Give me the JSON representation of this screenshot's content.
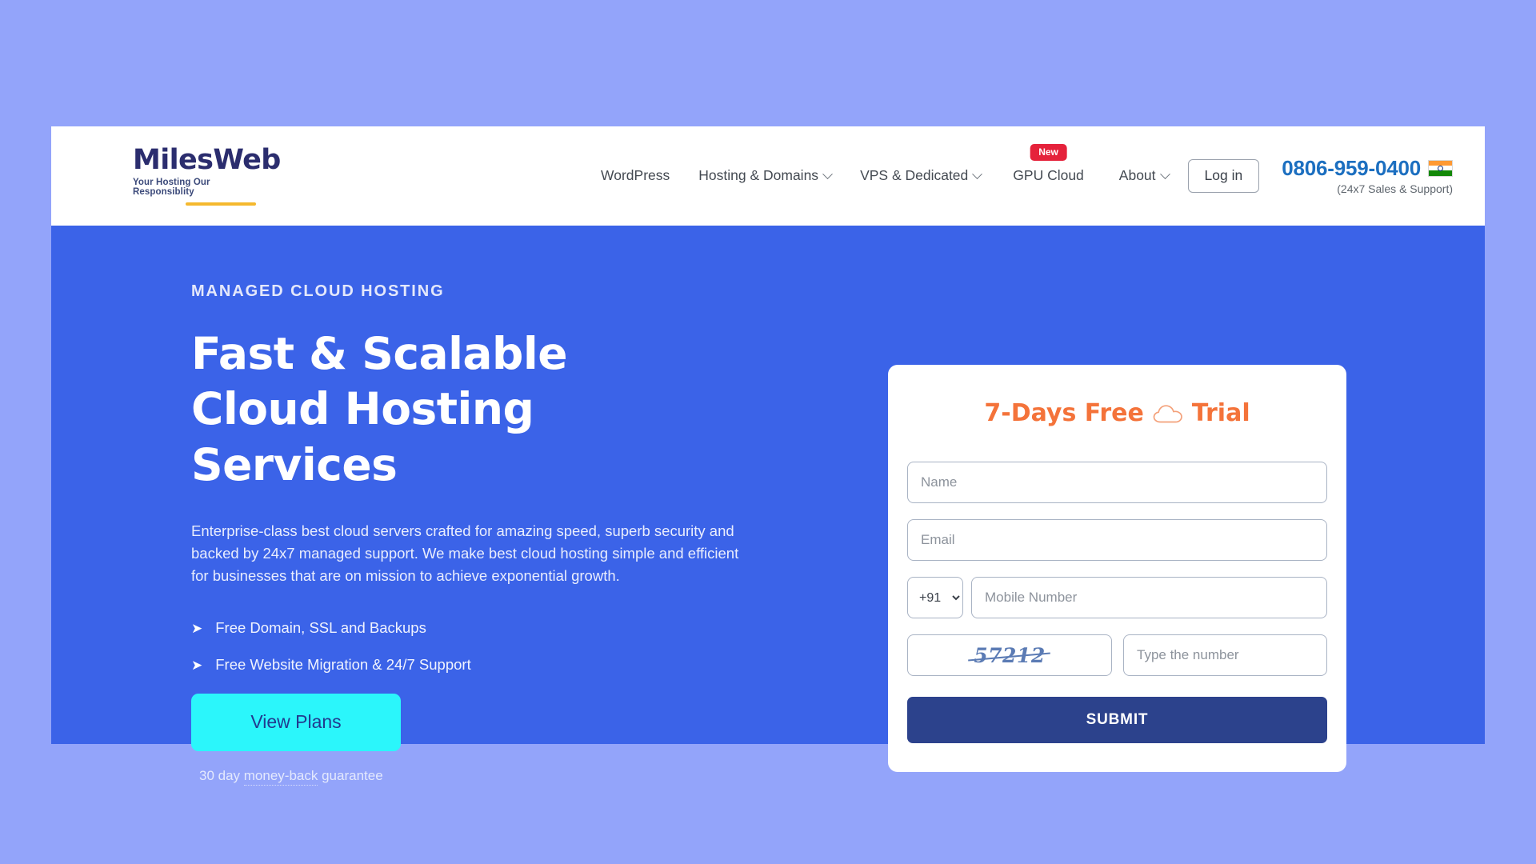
{
  "header": {
    "logo": {
      "word": "MilesWeb",
      "tagline": "Your Hosting Our Responsiblity"
    },
    "nav": [
      {
        "label": "WordPress",
        "has_caret": false,
        "badge": null
      },
      {
        "label": "Hosting & Domains",
        "has_caret": true,
        "badge": null
      },
      {
        "label": "VPS & Dedicated",
        "has_caret": true,
        "badge": null
      },
      {
        "label": "GPU Cloud",
        "has_caret": false,
        "badge": "New"
      },
      {
        "label": "About",
        "has_caret": true,
        "badge": null
      }
    ],
    "login_label": "Log in",
    "phone": "0806-959-0400",
    "phone_sub": "(24x7 Sales & Support)",
    "flag": "india-flag"
  },
  "hero": {
    "eyebrow": "MANAGED CLOUD HOSTING",
    "title": "Fast & Scalable Cloud Hosting Services",
    "description": "Enterprise-class best cloud servers crafted for amazing speed, superb security and backed by 24x7 managed support. We make best cloud hosting simple and efficient for businesses that are on mission to achieve exponential growth.",
    "features": [
      {
        "arrow": "➤",
        "label": "Free Domain, SSL and Backups"
      },
      {
        "arrow": "➤",
        "label": "Free Website Migration & 24/7 Support"
      }
    ],
    "cta_label": "View Plans",
    "guarantee_prefix": "30 day ",
    "guarantee_link": "money-back",
    "guarantee_suffix": " guarantee"
  },
  "form": {
    "title_before": "7-Days Free",
    "title_after": "Trial",
    "icon": "cloud-icon",
    "name_placeholder": "Name",
    "name_value": "",
    "email_placeholder": "Email",
    "email_value": "",
    "country_code": "+91",
    "country_code_options": [
      "+91"
    ],
    "mobile_placeholder": "Mobile Number",
    "mobile_value": "",
    "captcha_code": "57212",
    "captcha_placeholder": "Type the number",
    "captcha_value": "",
    "submit_label": "SUBMIT"
  },
  "colors": {
    "page_background": "#93a4fa",
    "hero_background": "#3b63e8",
    "accent_cyan": "#2bf6fb",
    "accent_orange": "#f4733a",
    "submit_navy": "#2c428c",
    "badge_red": "#e5223b",
    "phone_blue": "#1c6fc0",
    "logo_navy": "#2b2d6e",
    "logo_underline": "#f5b82e"
  }
}
